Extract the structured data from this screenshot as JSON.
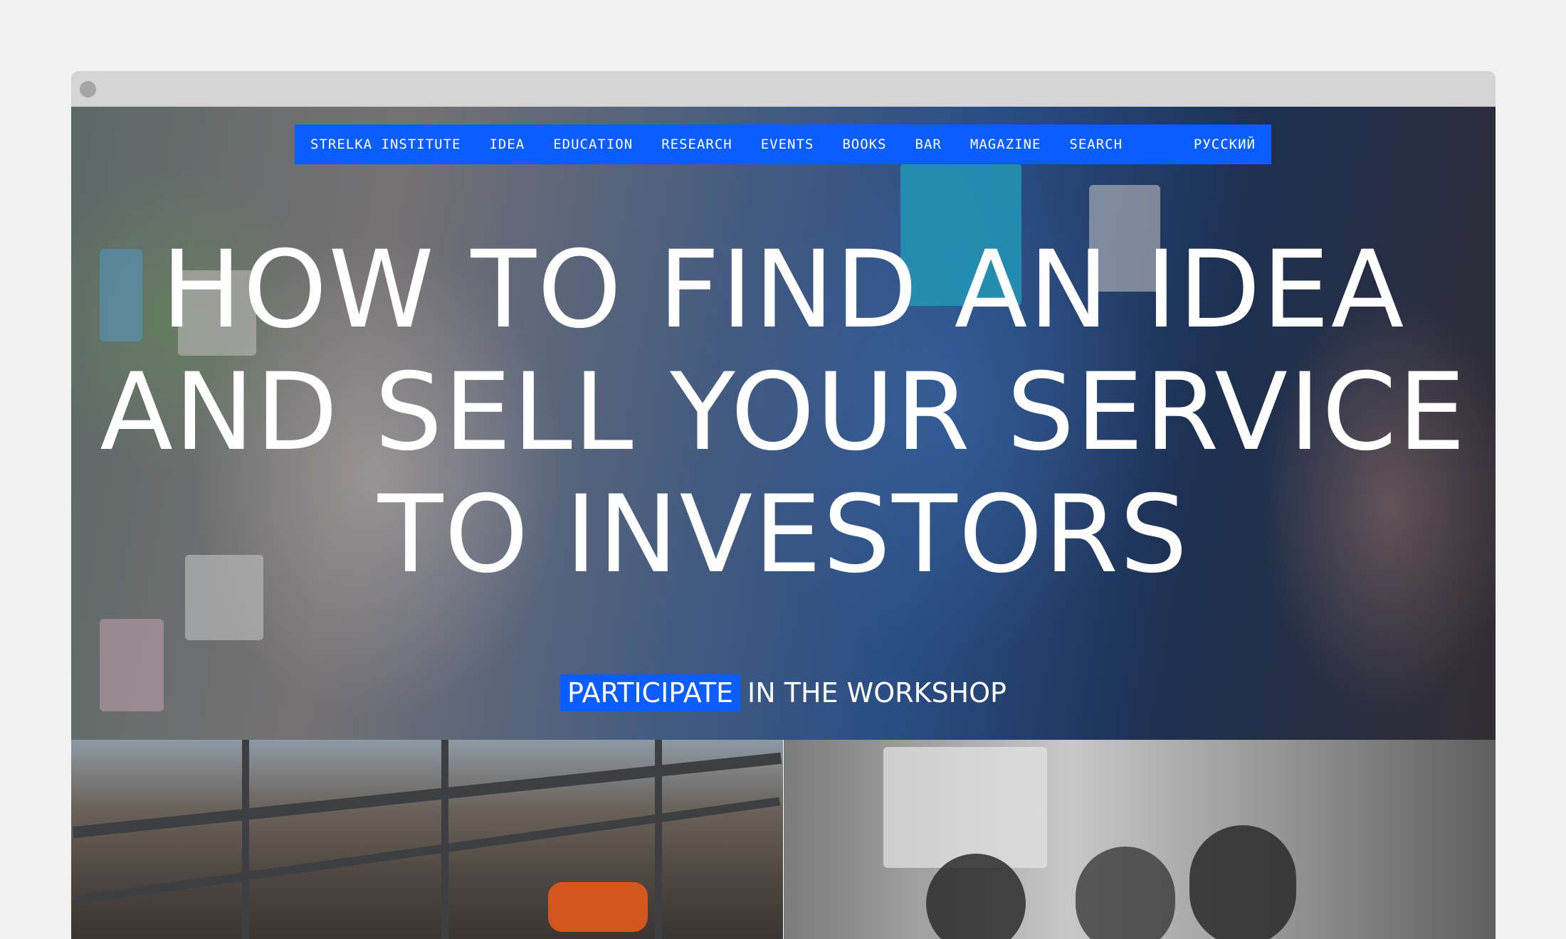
{
  "nav": {
    "items": [
      {
        "label": "STRELKA INSTITUTE"
      },
      {
        "label": "IDEA"
      },
      {
        "label": "EDUCATION"
      },
      {
        "label": "RESEARCH"
      },
      {
        "label": "EVENTS"
      },
      {
        "label": "BOOKS"
      },
      {
        "label": "BAR"
      },
      {
        "label": "MAGAZINE"
      },
      {
        "label": "SEARCH"
      }
    ],
    "language": "РУССКИЙ"
  },
  "hero": {
    "headline_lines": [
      "HOW TO FIND AN IDEA",
      "AND SELL YOUR SERVICE",
      "TO INVESTORS"
    ],
    "cta_label": "PARTICIPATE",
    "cta_suffix": "IN THE WORKSHOP"
  },
  "colors": {
    "accent": "#0a5dff",
    "page_background": "#f1f1f1",
    "title_bar": "#d4d4d4"
  }
}
